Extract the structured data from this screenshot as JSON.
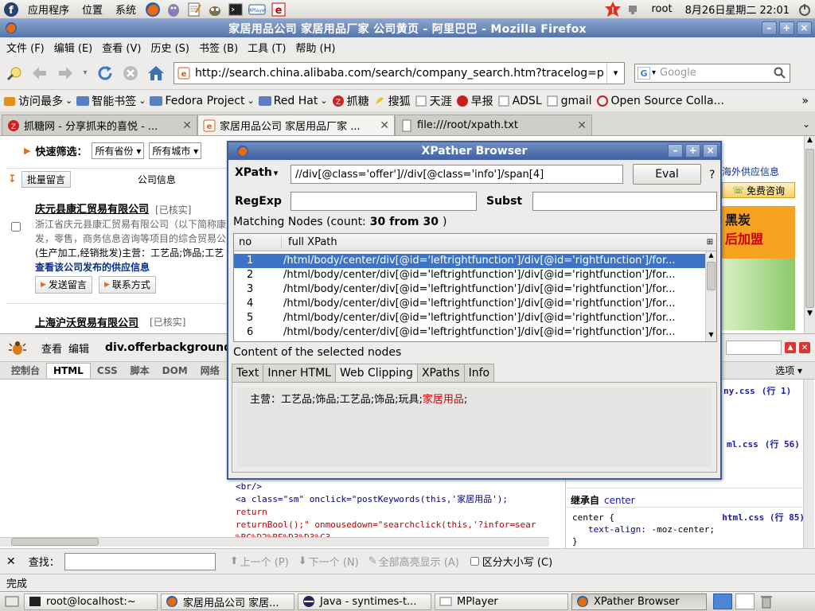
{
  "panel": {
    "menus": [
      "应用程序",
      "位置",
      "系统"
    ],
    "user": "root",
    "datetime": "8月26日星期二 22:01"
  },
  "firefox": {
    "title": "家居用品公司 家居用品厂家 公司黄页 - 阿里巴巴 - Mozilla Firefox",
    "menu": [
      "文件 (F)",
      "编辑 (E)",
      "查看 (V)",
      "历史 (S)",
      "书签 (B)",
      "工具 (T)",
      "帮助 (H)"
    ],
    "url": "http://search.china.alibaba.com/search/company_search.htm?tracelog=p",
    "search_placeholder": "Google",
    "bookmarks": [
      "访问最多",
      "智能书签",
      "Fedora Project",
      "Red Hat",
      "抓糖",
      "搜狐",
      "天涯",
      "早报",
      "ADSL",
      "gmail",
      "Open Source Colla..."
    ],
    "tabs": [
      "抓糖网 - 分享抓来的喜悦 - ...",
      "家居用品公司 家居用品厂家 ...",
      "file:///root/xpath.txt"
    ]
  },
  "page": {
    "filter_label": "快速筛选：",
    "province": "所有省份",
    "city": "所有城市",
    "batch_msg": "批量留言",
    "col_company": "公司信息",
    "overseas": "海外供应信息",
    "free_consult": "免费咨询",
    "ad_line1": "黑炭",
    "ad_line2": "后加盟",
    "company1": {
      "name": "庆元县康汇贸易有限公司",
      "verified": "[已核实]",
      "desc1": "浙江省庆元县康汇贸易有限公司（以下简称康",
      "desc2": "发，零售，商务信息咨询等项目的综合贸易公",
      "desc3": "(生产加工,经销批发)主营：工艺品;饰品;工艺",
      "supply": "查看该公司发布的供应信息",
      "send_msg": "发送留言",
      "contact": "联系方式"
    },
    "company2": {
      "name": "上海沪沃贸易有限公司",
      "verified": "[已核实]"
    }
  },
  "firebug": {
    "inspect": "查看",
    "edit": "编辑",
    "breadcrumb": "div.offerbackground",
    "tabs": [
      "控制台",
      "HTML",
      "CSS",
      "脚本",
      "DOM",
      "网络"
    ],
    "options": "选项",
    "source": [
      {
        "text": "<br/>"
      },
      {
        "text": "<a class=\"sm\" onclick=\"postKeywords(this,'家居用品');"
      },
      {
        "text": "return"
      },
      {
        "text": "returnBool();\" onmousedown=\"searchclick(this,'?infor=sear"
      },
      {
        "text": "%BC%D2%BE%D3%D3%C3"
      }
    ],
    "css_refs": [
      {
        "file": "ny.css",
        "line": "(行 1)"
      },
      {
        "file": "ml.css",
        "line": "(行 56)"
      }
    ],
    "inherit_label": "继承自",
    "inherit_from": "center",
    "rule_selector": "center {",
    "rule_file": "html.css",
    "rule_line": "(行 85)",
    "rule_prop": "text-align:",
    "rule_value": "-moz-center;",
    "rule_close": "}"
  },
  "findbar": {
    "label": "查找：",
    "prev": "上一个 (P)",
    "next": "下一个 (N)",
    "highlight": "全部高亮显示 (A)",
    "match_case": "区分大小写 (C)"
  },
  "status": "完成",
  "taskbar": [
    "root@localhost:~",
    "家居用品公司 家居...",
    "Java - syntimes-t...",
    "MPlayer",
    "XPather Browser"
  ],
  "xpather": {
    "title": "XPather Browser",
    "xpath_label": "XPath",
    "xpath_value": "//div[@class='offer']//div[@class='info']/span[4]",
    "eval": "Eval",
    "help": "?",
    "regexp_label": "RegExp",
    "subst_label": "Subst",
    "matching_prefix": "Matching Nodes (count:",
    "count": "30",
    "from_word": "from",
    "total": "30",
    "close_paren": ")",
    "col_no": "no",
    "col_path": "full XPath",
    "rows": [
      {
        "no": "1",
        "path": "/html/body/center/div[@id='leftrightfunction']/div[@id='rightfunction']/for..."
      },
      {
        "no": "2",
        "path": "/html/body/center/div[@id='leftrightfunction']/div[@id='rightfunction']/for..."
      },
      {
        "no": "3",
        "path": "/html/body/center/div[@id='leftrightfunction']/div[@id='rightfunction']/for..."
      },
      {
        "no": "4",
        "path": "/html/body/center/div[@id='leftrightfunction']/div[@id='rightfunction']/for..."
      },
      {
        "no": "5",
        "path": "/html/body/center/div[@id='leftrightfunction']/div[@id='rightfunction']/for..."
      },
      {
        "no": "6",
        "path": "/html/body/center/div[@id='leftrightfunction']/div[@id='rightfunction']/for..."
      }
    ],
    "content_label": "Content of the selected nodes",
    "tabs": [
      "Text",
      "Inner HTML",
      "Web Clipping",
      "XPaths",
      "Info"
    ],
    "clip_prefix": "主营：工艺品;饰品;工艺品;饰品;玩具;",
    "clip_highlight": "家居用品",
    "clip_suffix": ";"
  },
  "colors": {
    "accent": "#3d74c8",
    "title_blue": "#3f61a0",
    "link_red": "#cc0000",
    "highlight_red": "#d40000"
  }
}
